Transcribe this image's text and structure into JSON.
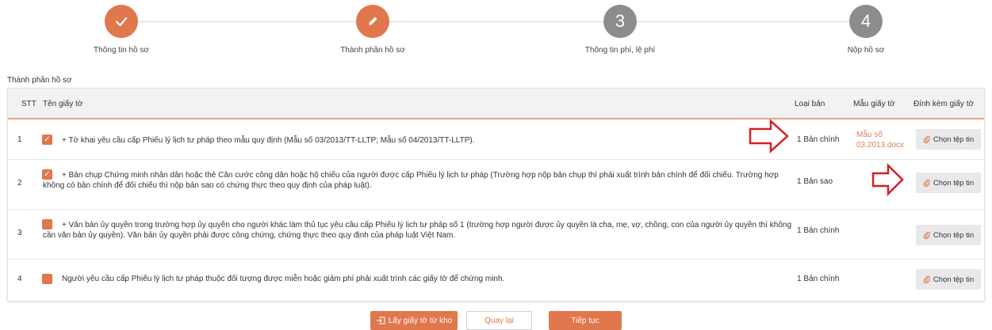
{
  "stepper": {
    "steps": [
      {
        "icon": "check-icon",
        "label": "Thông tin hồ sơ",
        "state": "done"
      },
      {
        "icon": "pencil-icon",
        "label": "Thành phần hồ sơ",
        "state": "active"
      },
      {
        "number": "3",
        "label": "Thông tin phí, lệ phí",
        "state": "pending"
      },
      {
        "number": "4",
        "label": "Nộp hồ sơ",
        "state": "pending"
      }
    ]
  },
  "section": {
    "title": "Thành phần hồ sơ"
  },
  "table": {
    "headers": {
      "stt": "STT",
      "name": "Tên giấy tờ",
      "type": "Loại bản",
      "template": "Mẫu giấy tờ",
      "attach": "Đính kèm giấy tờ"
    },
    "rows": [
      {
        "stt": "1",
        "checked": true,
        "text": "+ Tờ khai yêu cầu cấp Phiếu lý lịch tư pháp theo mẫu quy định (Mẫu số 03/2013/TT-LLTP; Mẫu số 04/2013/TT-LLTP).",
        "type": "1 Bản chính",
        "template_line1": "Mẫu số",
        "template_line2": "03.2013.docx",
        "attach_label": "Chọn tệp tin"
      },
      {
        "stt": "2",
        "checked": true,
        "text": "+ Bản chụp Chứng minh nhân dân hoặc thẻ Căn cước công dân hoặc hộ chiếu của người được cấp Phiếu lý lịch tư pháp (Trường hợp nộp bản chụp thì phải xuất trình bản chính để đối chiếu. Trường hợp không có bản chính để đối chiếu thì nộp bản sao có chứng thực theo quy định của pháp luật).",
        "type": "1 Bản sao",
        "attach_label": "Chọn tệp tin"
      },
      {
        "stt": "3",
        "checked": false,
        "text": "+ Văn bản ủy quyền trong trường hợp ủy quyền cho người khác làm thủ tục yêu cầu cấp Phiếu lý lịch tư pháp số 1 (trường hợp người được ủy quyền là cha, mẹ, vợ, chồng, con của người ủy quyền thì không cần văn bản ủy quyền). Văn bản ủy quyền phải được công chứng, chứng thực theo quy định của pháp luật Việt Nam.",
        "type": "1 Bản chính",
        "attach_label": "Chọn tệp tin"
      },
      {
        "stt": "4",
        "checked": false,
        "text": "Người yêu cầu cấp Phiếu lý lịch tư pháp thuộc đối tượng được miễn hoặc giảm phí phải xuất trình các giấy tờ để chứng minh.",
        "type": "1 Bản chính",
        "attach_label": "Chọn tệp tin"
      }
    ]
  },
  "footer": {
    "import_label": "Lấy giấy tờ từ kho",
    "back_label": "Quay lại",
    "next_label": "Tiếp tục"
  },
  "colors": {
    "accent": "#e0774d",
    "pending": "#8c8c8c",
    "arrow": "#d32027"
  }
}
